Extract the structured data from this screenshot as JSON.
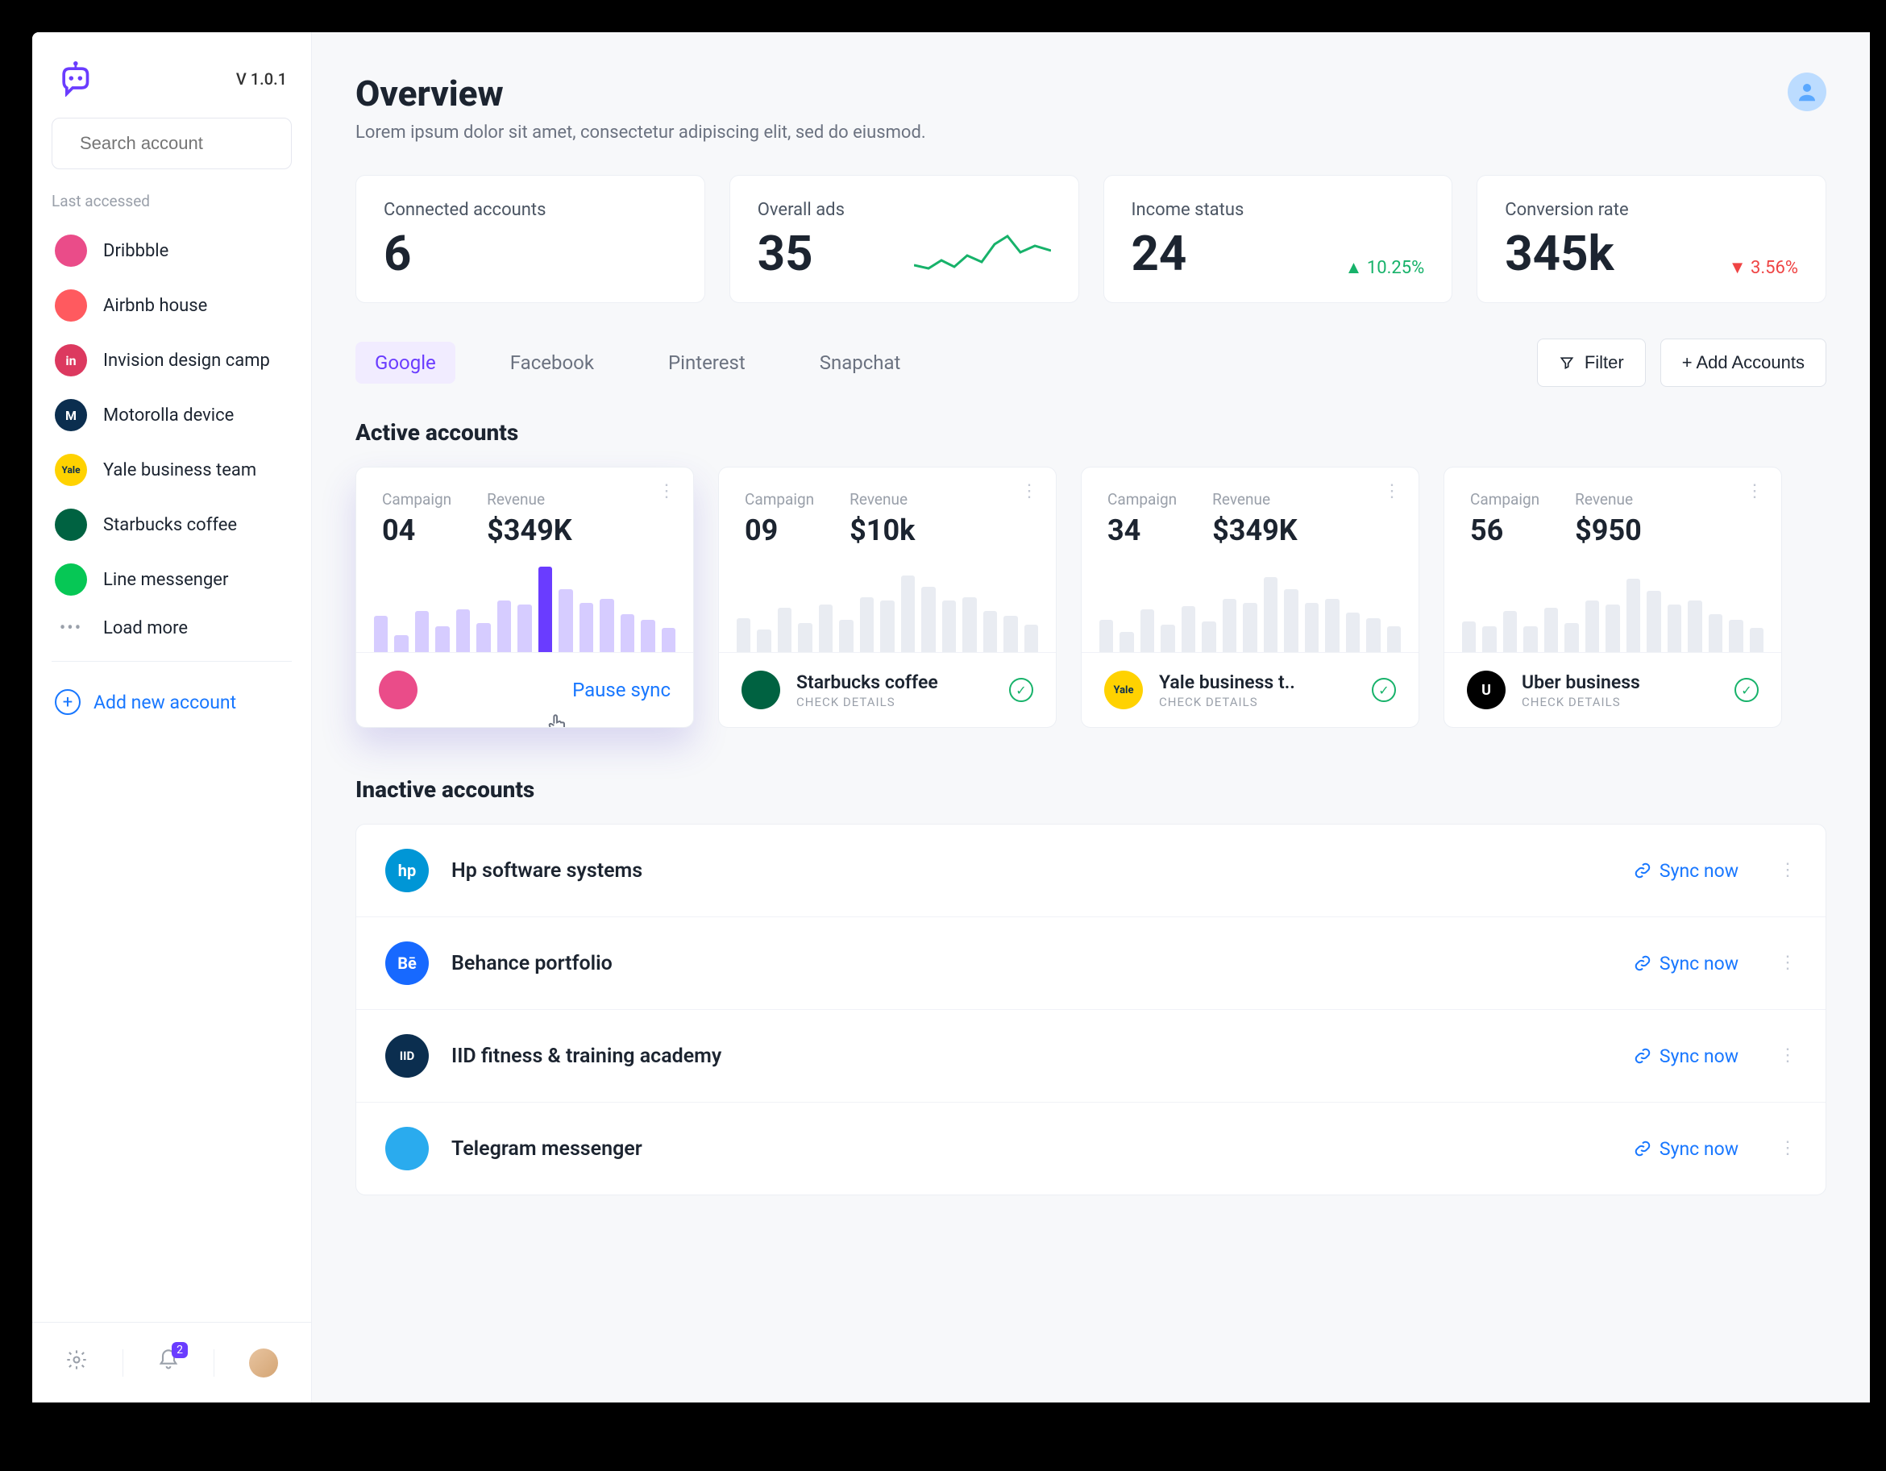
{
  "version": "V 1.0.1",
  "search": {
    "placeholder": "Search account"
  },
  "sidebar": {
    "label": "Last accessed",
    "items": [
      {
        "name": "Dribbble",
        "bg": "#ea4c89",
        "txt": ""
      },
      {
        "name": "Airbnb house",
        "bg": "#ff5a5f",
        "txt": ""
      },
      {
        "name": "Invision design camp",
        "bg": "#dc395f",
        "txt": "in"
      },
      {
        "name": "Motorolla device",
        "bg": "#0b2e4f",
        "txt": "M"
      },
      {
        "name": "Yale business team",
        "bg": "#ffd200",
        "txt": "Yale",
        "fg": "#0b2e4f"
      },
      {
        "name": "Starbucks coffee",
        "bg": "#006241",
        "txt": ""
      },
      {
        "name": "Line messenger",
        "bg": "#06c755",
        "txt": ""
      }
    ],
    "load_more": "Load more",
    "add_new": "Add new account",
    "bell_badge": "2"
  },
  "header": {
    "title": "Overview",
    "subtitle": "Lorem ipsum dolor sit amet, consectetur adipiscing elit, sed do eiusmod."
  },
  "stats": [
    {
      "label": "Connected accounts",
      "value": "6"
    },
    {
      "label": "Overall ads",
      "value": "35"
    },
    {
      "label": "Income status",
      "value": "24",
      "trend": "up",
      "trend_val": "10.25%"
    },
    {
      "label": "Conversion rate",
      "value": "345k",
      "trend": "down",
      "trend_val": "3.56%"
    }
  ],
  "tabs": [
    "Google",
    "Facebook",
    "Pinterest",
    "Snapchat"
  ],
  "active_tab": 0,
  "filter_label": "Filter",
  "add_accounts_label": "+ Add Accounts",
  "active_title": "Active accounts",
  "inactive_title": "Inactive accounts",
  "campaign_label": "Campaign",
  "revenue_label": "Revenue",
  "check_details": "CHECK DETAILS",
  "pause_sync": "Pause sync",
  "sync_now": "Sync now",
  "active_cards": [
    {
      "campaign": "04",
      "revenue": "$349K",
      "bars": [
        42,
        20,
        48,
        30,
        50,
        34,
        60,
        56,
        100,
        74,
        58,
        62,
        44,
        38,
        28
      ],
      "highlight": true,
      "bar_color": "#d6ccff",
      "bar_hl": "#6a3cff",
      "brand": "Dribbble",
      "brand_bg": "#ea4c89",
      "brand_txt": "",
      "show_pause": true
    },
    {
      "campaign": "09",
      "revenue": "$10k",
      "bars": [
        40,
        26,
        52,
        34,
        56,
        38,
        64,
        60,
        90,
        76,
        60,
        64,
        48,
        42,
        32
      ],
      "bar_color": "#e9ecf2",
      "brand": "Starbucks coffee",
      "brand_bg": "#006241",
      "brand_txt": ""
    },
    {
      "campaign": "34",
      "revenue": "$349K",
      "bars": [
        38,
        24,
        50,
        32,
        54,
        36,
        62,
        58,
        88,
        74,
        58,
        62,
        46,
        40,
        30
      ],
      "bar_color": "#e9ecf2",
      "brand": "Yale business t..",
      "brand_bg": "#ffd200",
      "brand_txt": "Yale",
      "brand_fg": "#0b2e4f"
    },
    {
      "campaign": "56",
      "revenue": "$950",
      "bars": [
        36,
        30,
        48,
        30,
        52,
        34,
        60,
        56,
        86,
        72,
        56,
        60,
        44,
        38,
        28
      ],
      "bar_color": "#e9ecf2",
      "brand": "Uber business",
      "brand_bg": "#000000",
      "brand_txt": "U"
    }
  ],
  "inactive": [
    {
      "name": "Hp software systems",
      "bg": "#0096d6",
      "txt": "hp"
    },
    {
      "name": "Behance portfolio",
      "bg": "#1769ff",
      "txt": "Bē"
    },
    {
      "name": "IID fitness & training academy",
      "bg": "#0b2e4f",
      "txt": "IID"
    },
    {
      "name": "Telegram messenger",
      "bg": "#2aabee",
      "txt": ""
    }
  ],
  "chart_data": {
    "type": "bar",
    "note": "Mini bar-sparklines per account card; values are relative bar heights (0-100).",
    "cards": [
      {
        "brand": "Dribbble",
        "values": [
          42,
          20,
          48,
          30,
          50,
          34,
          60,
          56,
          100,
          74,
          58,
          62,
          44,
          38,
          28
        ]
      },
      {
        "brand": "Starbucks coffee",
        "values": [
          40,
          26,
          52,
          34,
          56,
          38,
          64,
          60,
          90,
          76,
          60,
          64,
          48,
          42,
          32
        ]
      },
      {
        "brand": "Yale business team",
        "values": [
          38,
          24,
          50,
          32,
          54,
          36,
          62,
          58,
          88,
          74,
          58,
          62,
          46,
          40,
          30
        ]
      },
      {
        "brand": "Uber business",
        "values": [
          36,
          30,
          48,
          30,
          52,
          34,
          60,
          56,
          86,
          72,
          56,
          60,
          44,
          38,
          28
        ]
      }
    ]
  }
}
